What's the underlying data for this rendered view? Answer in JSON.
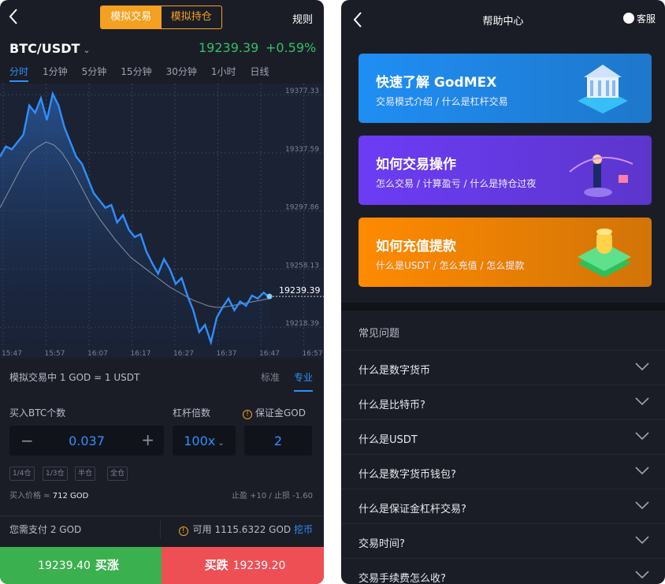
{
  "left": {
    "segment": {
      "active": "模拟交易",
      "inactive": "模拟持仓"
    },
    "rules": "规则",
    "pair": "BTC/USDT",
    "last_price": "19239.39",
    "change": "+0.59%",
    "tabs": [
      "分时",
      "1分钟",
      "5分钟",
      "15分钟",
      "30分钟",
      "1小时",
      "日线"
    ],
    "chart_data": {
      "type": "line",
      "x_ticks": [
        "15:47",
        "15:57",
        "16:07",
        "16:17",
        "16:27",
        "16:37",
        "16:47",
        "16:57"
      ],
      "y_ticks": [
        "19377.33",
        "19337.59",
        "19297.86",
        "19258.13",
        "19218.39"
      ],
      "ylim": [
        19205,
        19385
      ],
      "current": "19239.39",
      "series": [
        {
          "values": [
            19335,
            19342,
            19340,
            19345,
            19350,
            19370,
            19365,
            19375,
            19360,
            19378,
            19370,
            19355,
            19345,
            19335,
            19330,
            19320,
            19310,
            19305,
            19300,
            19302,
            19290,
            19295,
            19285,
            19280,
            19282,
            19270,
            19262,
            19255,
            19265,
            19258,
            19248,
            19252,
            19240,
            19230,
            19215,
            19220,
            19208,
            19225,
            19232,
            19238,
            19230,
            19236,
            19233,
            19240,
            19238,
            19242,
            19239
          ]
        },
        {
          "values": [
            19300,
            19310,
            19320,
            19330,
            19338,
            19342,
            19345,
            19343,
            19338,
            19330,
            19320,
            19310,
            19300,
            19292,
            19285,
            19278,
            19272,
            19266,
            19262,
            19258,
            19254,
            19250,
            19246,
            19243,
            19240,
            19237,
            19235,
            19233,
            19232,
            19232,
            19233,
            19234,
            19235,
            19236,
            19237,
            19238
          ]
        }
      ]
    },
    "info_text": "模拟交易中 1 GOD = 1 USDT",
    "modes": [
      "标准",
      "专业"
    ],
    "buy_label": "买入BTC个数",
    "lever_label": "杠杆倍数",
    "margin_label": "保证金GOD",
    "amount": "0.037",
    "leverage": "100x",
    "margin": "2",
    "minus": "−",
    "plus": "+",
    "fractions": [
      "1/4仓",
      "1/3仓",
      "半仓",
      "全仓"
    ],
    "buy_price_label": "买入价格 ≈",
    "buy_price": "712 GOD",
    "tp_sl": "止盈 +10 / 止损 -1.60",
    "need_pay": "您需支付 2 GOD",
    "available": "可用 1115.6322 GOD",
    "mine": "挖币",
    "buy_btn_price": "19239.40",
    "buy_btn_label": "买涨",
    "sell_btn_label": "买跌",
    "sell_btn_price": "19239.20"
  },
  "right": {
    "title": "帮助中心",
    "service": "客服",
    "cards": [
      {
        "title": "快速了解 GodMEX",
        "subtitle": "交易模式介绍 / 什么是杠杆交易",
        "color": "#1f8ef4"
      },
      {
        "title": "如何交易操作",
        "subtitle": "怎么交易 / 计算盈亏 / 什么是持仓过夜",
        "color": "#6c3cf5"
      },
      {
        "title": "如何充值提款",
        "subtitle": "什么是USDT / 怎么充值 / 怎么提款",
        "color": "#ff8a00"
      }
    ],
    "faq_title": "常见问题",
    "faqs": [
      "什么是数字货币",
      "什么是比特币?",
      "什么是USDT",
      "什么是数字货币钱包?",
      "什么是保证金杠杆交易?",
      "交易时间?",
      "交易手续费怎么收?"
    ]
  }
}
